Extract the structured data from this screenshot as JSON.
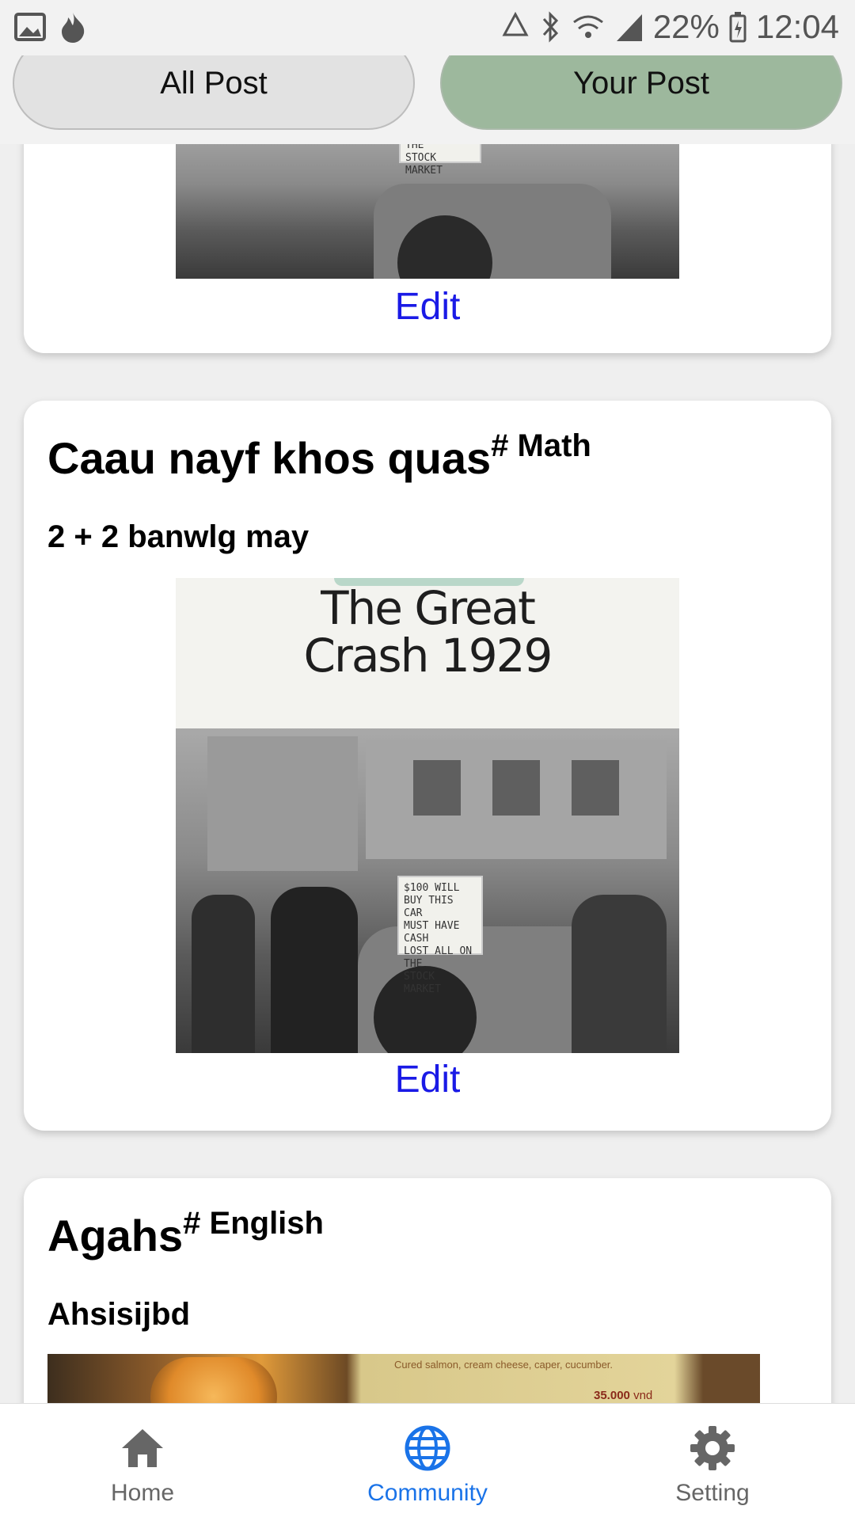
{
  "status_bar": {
    "battery": "22%",
    "time": "12:04",
    "icons": [
      "image-icon",
      "flame-icon",
      "recycle-icon",
      "bluetooth-icon",
      "wifi-icon",
      "signal-icon",
      "battery-icon"
    ]
  },
  "tabs": {
    "all_label": "All Post",
    "your_label": "Your Post",
    "active": "your",
    "active_color": "#9db89d"
  },
  "posts": [
    {
      "title": "",
      "tag": "",
      "body": "",
      "image": {
        "sign_text": "LOST ALL ON THE\nSTOCK MARKET"
      },
      "edit_label": "Edit"
    },
    {
      "title": "Caau nayf khos quas",
      "tag": "# Math",
      "body": "2 + 2 banwlg may",
      "image": {
        "cover_title_line1": "The Great",
        "cover_title_line2": "Crash 1929",
        "sign_text": "$100 WILL\nBUY THIS CAR\nMUST HAVE CASH\nLOST ALL ON THE\nSTOCK MARKET"
      },
      "edit_label": "Edit"
    },
    {
      "title": "Agahs",
      "tag": "# English",
      "body": "Ahsisijbd",
      "image": {
        "caption": "Cured salmon, cream cheese, caper, cucumber.",
        "price": "35.000",
        "currency": "vnd"
      }
    }
  ],
  "bottom_nav": {
    "items": [
      {
        "label": "Home",
        "icon": "home-icon"
      },
      {
        "label": "Community",
        "icon": "globe-icon"
      },
      {
        "label": "Setting",
        "icon": "gear-icon"
      }
    ],
    "active": "Community",
    "active_color": "#1a73e8"
  }
}
